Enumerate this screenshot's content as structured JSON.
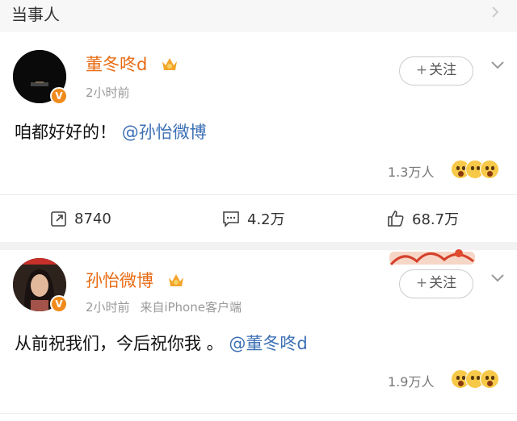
{
  "header": {
    "title": "当事人"
  },
  "posts": [
    {
      "username": "董冬咚d",
      "time": "2小时前",
      "source": "",
      "follow_label": "关注",
      "text": "咱都好好的！",
      "mention": "@孙怡微博",
      "likes": "1.3万人"
    },
    {
      "username": "孙怡微博",
      "time": "2小时前",
      "source": "来自iPhone客户端",
      "follow_label": "关注",
      "text": "从前祝我们，今后祝你我 。",
      "mention": "@董冬咚d",
      "likes": "1.9万人"
    }
  ],
  "actions": {
    "repost": "8740",
    "comment": "4.2万",
    "like": "68.7万"
  },
  "colors": {
    "username": "#e86b14",
    "mention": "#3b6fb4",
    "vip_badge": "#f08a1a"
  }
}
